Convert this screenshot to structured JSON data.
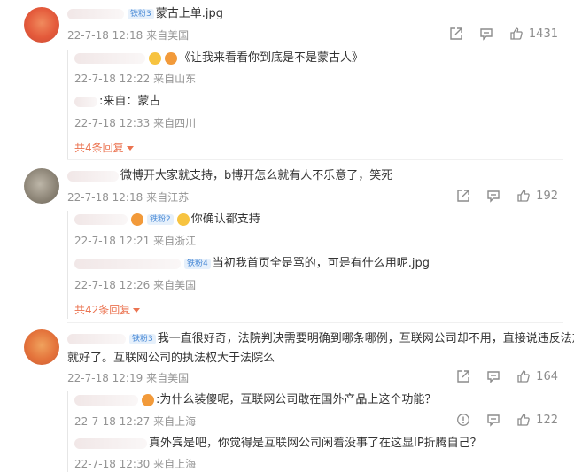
{
  "comments": [
    {
      "text": "蒙古上单.jpg",
      "time": "22-7-18 12:18",
      "source": "来自美国",
      "badge": "铁粉3",
      "likes": "1431",
      "replies": [
        {
          "text": "《让我来看看你到底是不是蒙古人》",
          "time": "22-7-18 12:22",
          "source": "来自山东"
        },
        {
          "text": ":来自：蒙古",
          "time": "22-7-18 12:33",
          "source": "来自四川"
        }
      ],
      "more": "共4条回复"
    },
    {
      "text": "微博开大家就支持，b博开怎么就有人不乐意了，笑死",
      "time": "22-7-18 12:18",
      "source": "来自江苏",
      "likes": "192",
      "replies": [
        {
          "text": "你确认都支持",
          "time": "22-7-18 12:21",
          "source": "来自浙江",
          "badge": "铁粉2"
        },
        {
          "text": "当初我首页全是骂的，可是有什么用呢.jpg",
          "time": "22-7-18 12:26",
          "source": "来自美国",
          "badge": "铁粉4"
        }
      ],
      "more": "共42条回复"
    },
    {
      "text_line1": "我一直很好奇，法院判决需要明确到哪条哪例，互联网公司却不用，直接说违反法规",
      "text_line2": "就好了。互联网公司的执法权大于法院么",
      "time": "22-7-18 12:19",
      "source": "来自美国",
      "badge": "铁粉3",
      "likes": "164",
      "replies": [
        {
          "text": ":为什么装傻呢，互联网公司敢在国外产品上这个功能？",
          "time": "22-7-18 12:27",
          "source": "来自上海",
          "likes": "122"
        },
        {
          "text": "真外宾是吧，你觉得是互联网公司闲着没事了在这显IP折腾自己？",
          "time": "22-7-18 12:30",
          "source": "来自上海"
        }
      ]
    }
  ]
}
